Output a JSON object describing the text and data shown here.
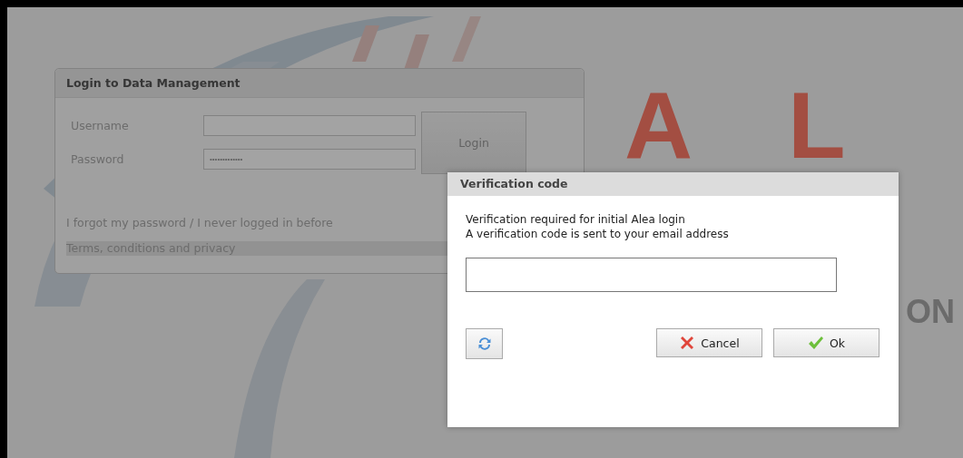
{
  "background": {
    "logo_letters": [
      "A",
      "L"
    ],
    "logo_word": "ON"
  },
  "login_panel": {
    "title": "Login to  Data Management",
    "username_label": "Username",
    "password_label": "Password",
    "password_value": "•••••••••••••",
    "login_button": "Login",
    "forgot_link": "I forgot my password / I never logged in before",
    "terms_link": "Terms, conditions and privacy"
  },
  "dialog": {
    "title": "Verification code",
    "lines": [
      "Verification required for initial Alea login",
      "A verification code is sent to your email address"
    ],
    "buttons": [
      {
        "kind": "refresh"
      },
      {
        "kind": "cancel",
        "label": "Cancel"
      },
      {
        "kind": "ok",
        "label": "Ok"
      }
    ]
  }
}
